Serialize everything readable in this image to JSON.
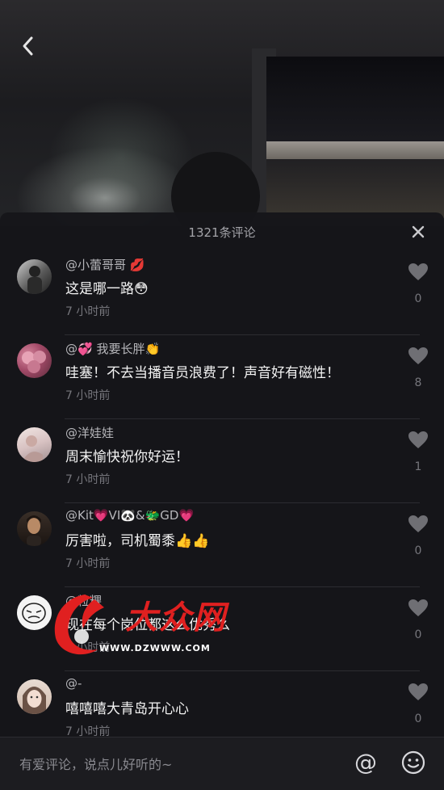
{
  "header": {
    "comment_count_title": "1321条评论"
  },
  "comments": [
    {
      "username": "@小蕾哥哥 💋",
      "text": "这是哪一路😳",
      "time": "7 小时前",
      "likes": "0"
    },
    {
      "username": "@💞 我要长胖👏",
      "text": "哇塞！不去当播音员浪费了！声音好有磁性！",
      "time": "7 小时前",
      "likes": "8"
    },
    {
      "username": "@洋娃娃",
      "text": "周末愉快祝你好运！",
      "time": "7 小时前",
      "likes": "1"
    },
    {
      "username": "@Kit💗VI🐼&🐲GD💗",
      "text": "厉害啦，司机蜀黍👍👍",
      "time": "7 小时前",
      "likes": "0"
    },
    {
      "username": "@粒粿",
      "text": "现在每个岗位都这么优秀么",
      "time": "7 小时前",
      "likes": "0"
    },
    {
      "username": "@-",
      "text": "嘻嘻嘻大青岛开心心",
      "time": "7 小时前",
      "likes": "0"
    }
  ],
  "input": {
    "placeholder": "有爱评论，说点儿好听的~",
    "at_label": "@"
  },
  "watermark": {
    "brand": "大众网",
    "url": "WWW.DZWWW.COM"
  },
  "icons": {
    "back": "chevron-left-icon",
    "close": "close-icon",
    "like": "heart-icon",
    "emoji": "smiley-icon"
  },
  "colors": {
    "sheet_bg": "#16161a",
    "muted_text": "#76767c",
    "watermark_red": "#e02020"
  }
}
